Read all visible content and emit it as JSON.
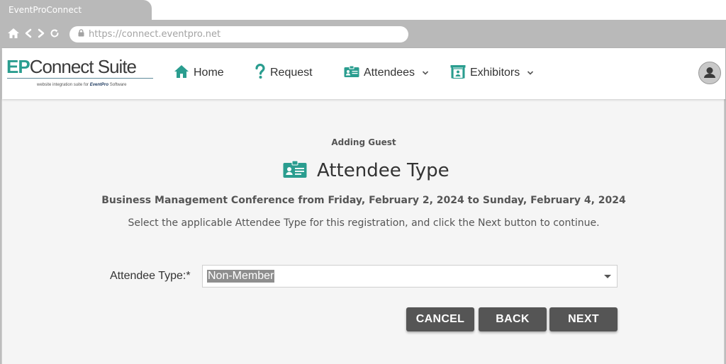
{
  "browser": {
    "tab_title": "EventProConnect",
    "url": "https://connect.eventpro.net"
  },
  "logo": {
    "ep": "EP",
    "connect_suite": "Connect Suite",
    "tagline_prefix": "website integration suite for",
    "tagline_brand": "EventPro",
    "tagline_suffix": "Software"
  },
  "nav": {
    "home": "Home",
    "request": "Request",
    "attendees": "Attendees",
    "exhibitors": "Exhibitors"
  },
  "page": {
    "subtitle": "Adding Guest",
    "title": "Attendee Type",
    "event_line": "Business Management Conference from Friday, February 2, 2024 to Sunday, February 4, 2024",
    "instructions": "Select the applicable Attendee Type for this registration, and click the Next button to continue."
  },
  "form": {
    "attendee_type_label": "Attendee Type:*",
    "attendee_type_value": "Non-Member"
  },
  "buttons": {
    "cancel": "CANCEL",
    "back": "BACK",
    "next": "NEXT"
  },
  "colors": {
    "accent_teal": "#2a9d8f",
    "button_gray": "#555555",
    "chrome_gray": "#b9b9b9"
  }
}
